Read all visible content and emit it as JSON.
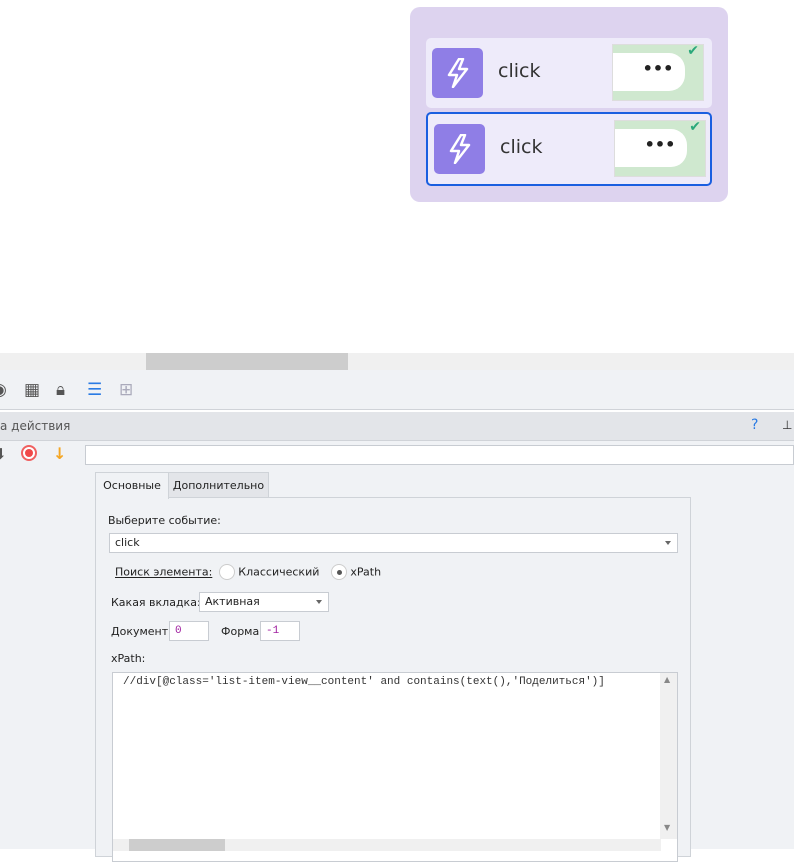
{
  "preview": {
    "items": [
      {
        "label": "click",
        "selected": false
      },
      {
        "label": "click",
        "selected": true
      }
    ],
    "thumb_dots": "•••"
  },
  "toolbar": {
    "icons": [
      "user-circle-icon",
      "grid-icon",
      "lock-icon",
      "list-icon",
      "add-box-icon"
    ]
  },
  "panel_header": {
    "title": "а действия",
    "help": "?",
    "pin": "⊥"
  },
  "tabs": [
    "Основные",
    "Дополнительно"
  ],
  "form": {
    "event_label": "Выберите событие:",
    "event_value": "click",
    "search_label": "Поиск элемента:",
    "radio_classic": "Классический",
    "radio_xpath": "xPath",
    "tab_label": "Какая вкладка:",
    "tab_value": "Активная",
    "doc_label": "Документ:",
    "doc_value": "0",
    "form_label": "Форма:",
    "form_value": "-1",
    "xpath_label": "xPath:",
    "xpath_value": "//div[@class='list-item-view__content' and contains(text(),'Поделиться')]"
  }
}
